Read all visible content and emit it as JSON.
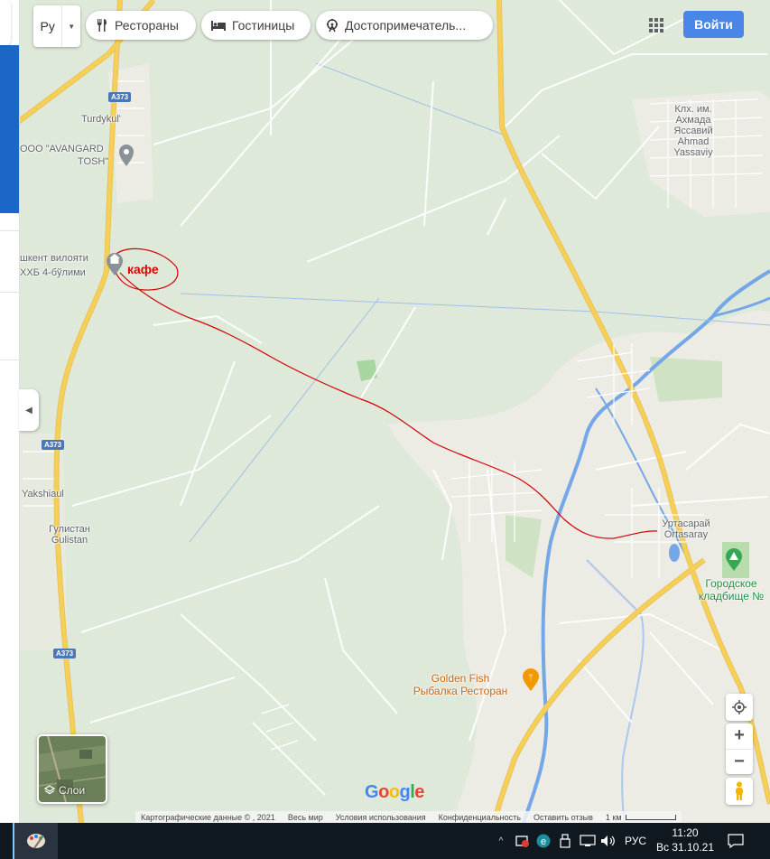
{
  "top_bar": {
    "language_code": "Ру",
    "chips": [
      {
        "label": "Рестораны",
        "icon": "fork-knife-icon"
      },
      {
        "label": "Гостиницы",
        "icon": "bed-icon"
      },
      {
        "label": "Достопримечатель...",
        "icon": "ferris-wheel-icon"
      }
    ],
    "apps_icon": "apps-grid-icon",
    "signin_label": "Войти"
  },
  "map_labels": {
    "turdykul": "Turdykul'",
    "avangard_line1": "ООО \"AVANGARD",
    "avangard_line2": "TOSH\"",
    "tashkent_line1": "шкент вилояти",
    "tashkent_line2": "ХХБ 4-бўлими",
    "kholkhoz_line1": "Клх. им.",
    "kholkhoz_line2": "Ахмада",
    "kholkhoz_line3": "Яссавий",
    "kholkhoz_line4": "Ahmad",
    "kholkhoz_line5": "Yassaviy",
    "yakshiaul": "Yakshiaul",
    "gulistan_ru": "Гулистан",
    "gulistan_en": "Gulistan",
    "urtasaray_ru": "Уртасарай",
    "urtasaray_en": "Ortasaray",
    "cemetery_line1": "Городское",
    "cemetery_line2": "кладбище №",
    "golden_fish_line1": "Golden Fish",
    "golden_fish_line2": "Рыбалка Ресторан",
    "road_a373": "A373",
    "annotation_cafe": "кафе"
  },
  "map_controls": {
    "my_location_icon": "crosshair-icon",
    "zoom_in": "+",
    "zoom_out": "−",
    "pegman_icon": "pegman-icon",
    "layers_label": "Слои",
    "layers_icon": "layers-icon"
  },
  "google_logo": "Google",
  "attribution": {
    "map_data": "Картографические данные © , 2021",
    "world": "Весь мир",
    "terms": "Условия использования",
    "privacy": "Конфиденциальность",
    "feedback": "Оставить отзыв",
    "scale": "1 км"
  },
  "taskbar": {
    "language": "РУС",
    "time": "11:20",
    "date": "Вс 31.10.21"
  },
  "colors": {
    "map_green": "#dfe9da",
    "town_beige": "#ecebe4",
    "road_yellow": "#f6cf56",
    "water_blue": "#74a7e8",
    "route_red": "#d10000",
    "signin_blue": "#4a86e8"
  }
}
